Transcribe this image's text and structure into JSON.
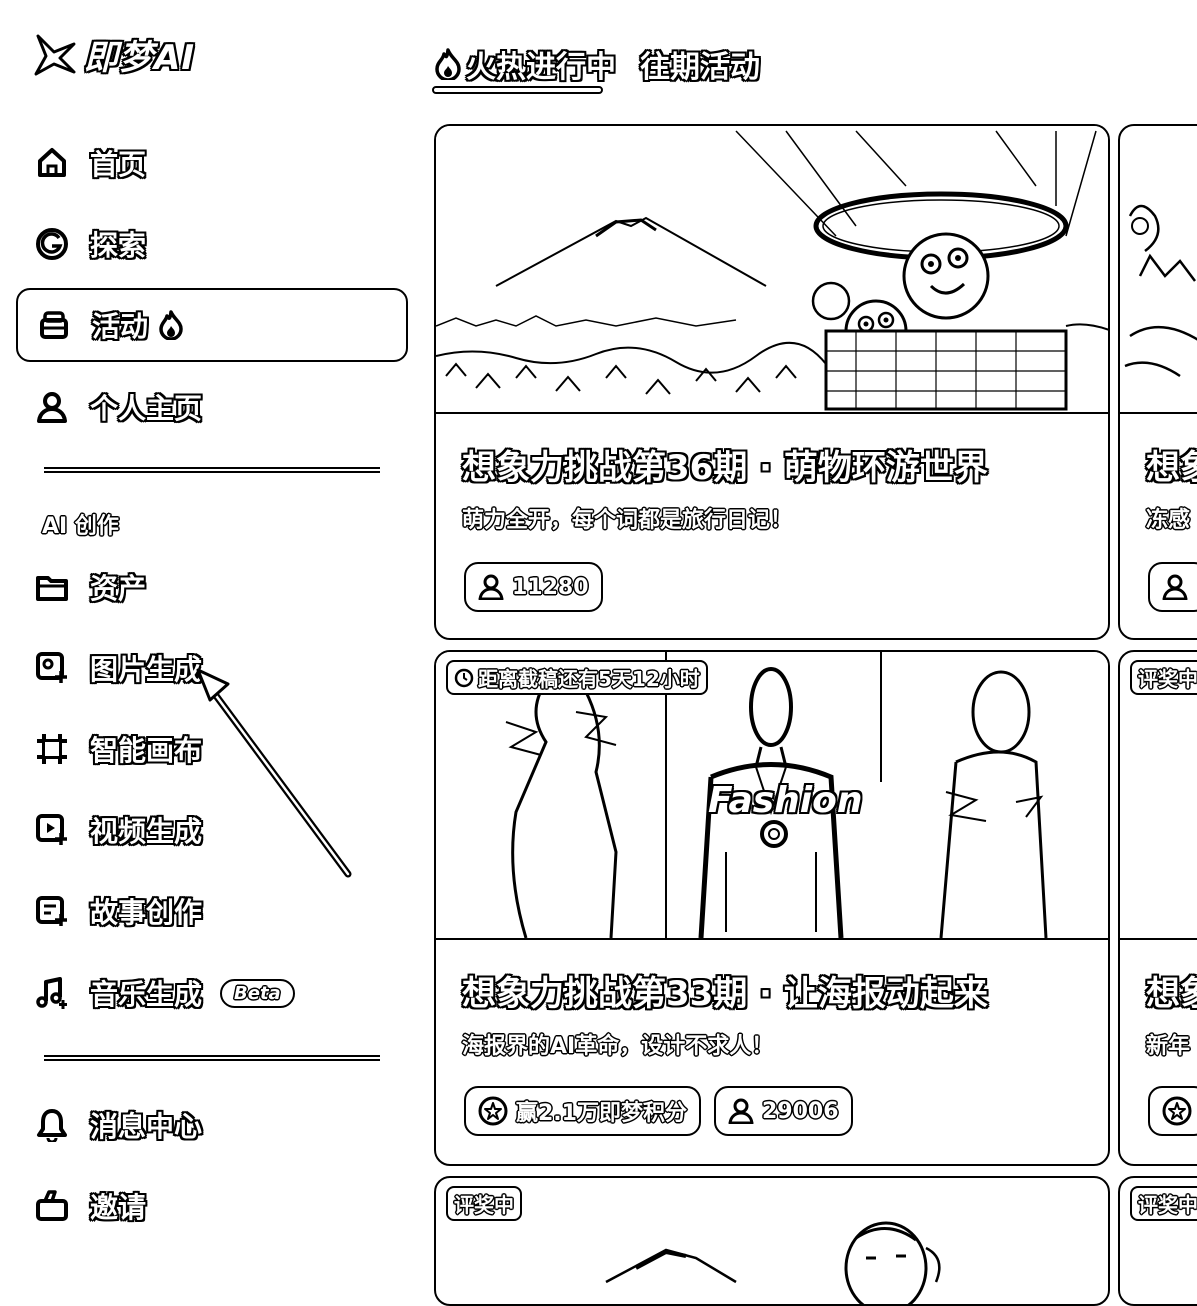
{
  "app": {
    "logo_text": "即梦AI"
  },
  "sidebar": {
    "items": [
      {
        "label": "首页",
        "icon": "home-icon"
      },
      {
        "label": "探索",
        "icon": "explore-icon"
      },
      {
        "label": "活动",
        "icon": "activity-icon",
        "active": true,
        "trailing_icon": "fire-icon"
      },
      {
        "label": "个人主页",
        "icon": "user-icon"
      }
    ],
    "section_title": "AI 创作",
    "create_items": [
      {
        "label": "资产",
        "icon": "folder-icon"
      },
      {
        "label": "图片生成",
        "icon": "image-gen-icon"
      },
      {
        "label": "智能画布",
        "icon": "canvas-icon"
      },
      {
        "label": "视频生成",
        "icon": "video-gen-icon"
      },
      {
        "label": "故事创作",
        "icon": "story-icon"
      },
      {
        "label": "音乐生成",
        "icon": "music-icon",
        "badge": "Beta"
      }
    ],
    "bottom_items": [
      {
        "label": "消息中心",
        "icon": "bell-icon"
      },
      {
        "label": "邀请",
        "icon": "invite-icon"
      }
    ]
  },
  "tabs": {
    "active_label": "火热进行中",
    "past_label": "往期活动"
  },
  "cards": {
    "card1": {
      "title": "想象力挑战第36期 · 萌物环游世界",
      "subtitle": "萌力全开，每个词都是旅行日记！",
      "participants": "11280"
    },
    "card2": {
      "deadline_badge": "距离截稿还有5天12小时",
      "image_text": "Fashion",
      "title": "想象力挑战第33期 · 让海报动起来",
      "subtitle": "海报界的AI革命，设计不求人！",
      "reward": "赢2.1万即梦积分",
      "participants": "29006"
    },
    "card3": {
      "badge": "评奖中"
    },
    "right_col": {
      "top_title_partial": "想象",
      "top_sub_partial": "冻感",
      "mid_badge_partial": "评奖中",
      "mid_title_partial": "想象",
      "mid_sub_partial": "新年",
      "bottom_badge_partial": "评奖中"
    }
  }
}
